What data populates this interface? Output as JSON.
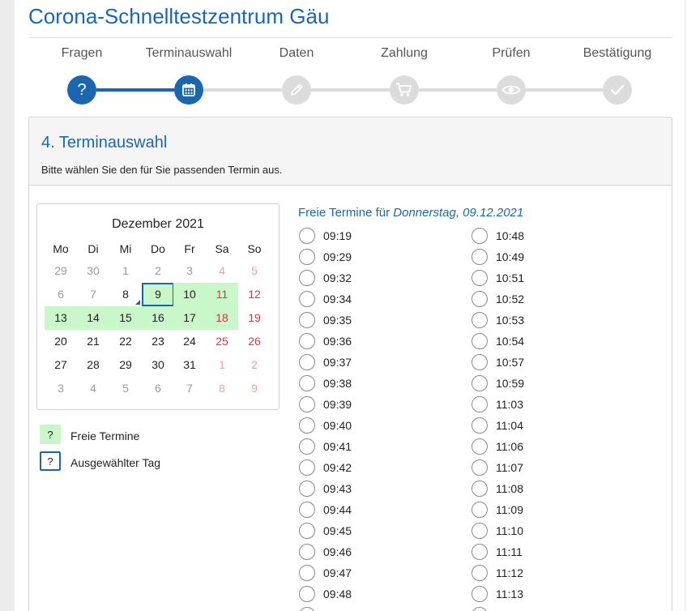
{
  "title": "Corona-Schnelltestzentrum Gäu",
  "steps": [
    {
      "label": "Fragen",
      "icon": "question-icon",
      "state": "done"
    },
    {
      "label": "Terminauswahl",
      "icon": "calendar-icon",
      "state": "active"
    },
    {
      "label": "Daten",
      "icon": "pencil-icon",
      "state": "todo"
    },
    {
      "label": "Zahlung",
      "icon": "cart-icon",
      "state": "todo"
    },
    {
      "label": "Prüfen",
      "icon": "eye-icon",
      "state": "todo"
    },
    {
      "label": "Bestätigung",
      "icon": "check-icon",
      "state": "todo"
    }
  ],
  "section": {
    "heading": "4. Terminauswahl",
    "instruction": "Bitte wählen Sie den für Sie passenden Termin aus."
  },
  "calendar": {
    "month_title": "Dezember 2021",
    "weekdays": [
      "Mo",
      "Di",
      "Mi",
      "Do",
      "Fr",
      "Sa",
      "So"
    ],
    "weeks": [
      [
        {
          "d": "29",
          "s": "muted"
        },
        {
          "d": "30",
          "s": "muted"
        },
        {
          "d": "1",
          "s": "muted"
        },
        {
          "d": "2",
          "s": "muted"
        },
        {
          "d": "3",
          "s": "muted"
        },
        {
          "d": "4",
          "s": "muted-weekend"
        },
        {
          "d": "5",
          "s": "muted-weekend"
        }
      ],
      [
        {
          "d": "6",
          "s": "muted"
        },
        {
          "d": "7",
          "s": "muted"
        },
        {
          "d": "8",
          "s": "today"
        },
        {
          "d": "9",
          "s": "selected"
        },
        {
          "d": "10",
          "s": "free"
        },
        {
          "d": "11",
          "s": "free-weekend"
        },
        {
          "d": "12",
          "s": "weekend"
        }
      ],
      [
        {
          "d": "13",
          "s": "free"
        },
        {
          "d": "14",
          "s": "free"
        },
        {
          "d": "15",
          "s": "free"
        },
        {
          "d": "16",
          "s": "free"
        },
        {
          "d": "17",
          "s": "free"
        },
        {
          "d": "18",
          "s": "free-weekend"
        },
        {
          "d": "19",
          "s": "weekend"
        }
      ],
      [
        {
          "d": "20",
          "s": "normal"
        },
        {
          "d": "21",
          "s": "normal"
        },
        {
          "d": "22",
          "s": "normal"
        },
        {
          "d": "23",
          "s": "normal"
        },
        {
          "d": "24",
          "s": "normal"
        },
        {
          "d": "25",
          "s": "weekend"
        },
        {
          "d": "26",
          "s": "weekend"
        }
      ],
      [
        {
          "d": "27",
          "s": "normal"
        },
        {
          "d": "28",
          "s": "normal"
        },
        {
          "d": "29",
          "s": "normal"
        },
        {
          "d": "30",
          "s": "normal"
        },
        {
          "d": "31",
          "s": "normal"
        },
        {
          "d": "1",
          "s": "muted-weekend"
        },
        {
          "d": "2",
          "s": "muted-weekend"
        }
      ],
      [
        {
          "d": "3",
          "s": "muted"
        },
        {
          "d": "4",
          "s": "muted"
        },
        {
          "d": "5",
          "s": "muted"
        },
        {
          "d": "6",
          "s": "muted"
        },
        {
          "d": "7",
          "s": "muted"
        },
        {
          "d": "8",
          "s": "muted-weekend"
        },
        {
          "d": "9",
          "s": "muted-weekend"
        }
      ]
    ]
  },
  "legend": {
    "symbol": "?",
    "free_label": "Freie Termine",
    "selected_label": "Ausgewählter Tag"
  },
  "slots": {
    "heading_prefix": "Freie Termine für",
    "heading_date": "Donnerstag, 09.12.2021",
    "left": [
      "09:19",
      "09:29",
      "09:32",
      "09:34",
      "09:35",
      "09:36",
      "09:37",
      "09:38",
      "09:39",
      "09:40",
      "09:41",
      "09:42",
      "09:43",
      "09:44",
      "09:45",
      "09:46",
      "09:47",
      "09:48"
    ],
    "right": [
      "10:48",
      "10:49",
      "10:51",
      "10:52",
      "10:53",
      "10:54",
      "10:57",
      "10:59",
      "11:03",
      "11:04",
      "11:06",
      "11:07",
      "11:08",
      "11:09",
      "11:10",
      "11:11",
      "11:12",
      "11:13"
    ]
  },
  "colors": {
    "accent": "#1a67b0",
    "free_day": "#c9f7c9",
    "weekend": "#d9363e",
    "inactive_step": "#dcdcdc"
  }
}
